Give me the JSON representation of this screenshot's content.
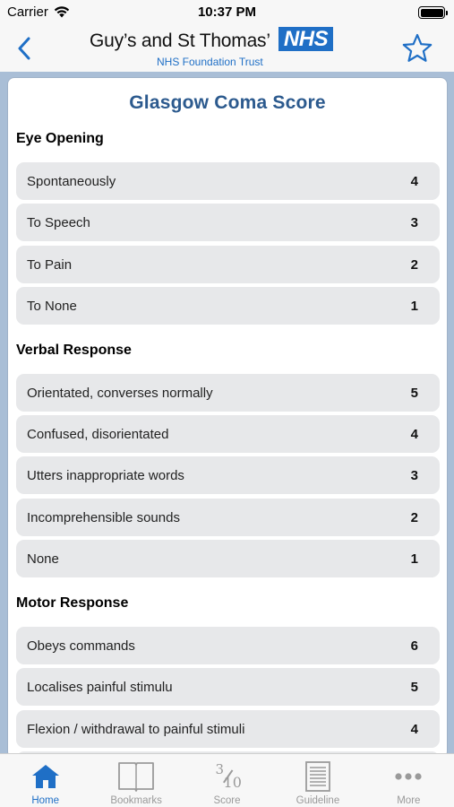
{
  "status": {
    "carrier": "Carrier",
    "time": "10:37 PM"
  },
  "header": {
    "org_name": "Guy’s and St Thomas’",
    "nhs_badge": "NHS",
    "trust_line": "NHS Foundation Trust"
  },
  "page": {
    "title": "Glasgow Coma Score"
  },
  "sections": [
    {
      "heading": "Eye Opening",
      "options": [
        {
          "label": "Spontaneously",
          "score": "4"
        },
        {
          "label": "To Speech",
          "score": "3"
        },
        {
          "label": "To Pain",
          "score": "2"
        },
        {
          "label": "To None",
          "score": "1"
        }
      ]
    },
    {
      "heading": "Verbal Response",
      "options": [
        {
          "label": "Orientated, converses normally",
          "score": "5"
        },
        {
          "label": "Confused, disorientated",
          "score": "4"
        },
        {
          "label": "Utters inappropriate words",
          "score": "3"
        },
        {
          "label": "Incomprehensible sounds",
          "score": "2"
        },
        {
          "label": "None",
          "score": "1"
        }
      ]
    },
    {
      "heading": "Motor Response",
      "options": [
        {
          "label": "Obeys commands",
          "score": "6"
        },
        {
          "label": "Localises painful stimulu",
          "score": "5"
        },
        {
          "label": "Flexion / withdrawal to painful stimuli",
          "score": "4"
        }
      ]
    }
  ],
  "tabs": [
    {
      "label": "Home",
      "icon": "home-icon",
      "active": true
    },
    {
      "label": "Bookmarks",
      "icon": "book-icon",
      "active": false
    },
    {
      "label": "Score",
      "icon": "score-fraction-icon",
      "fraction_num": "3",
      "fraction_den": "10",
      "active": false
    },
    {
      "label": "Guideline",
      "icon": "document-icon",
      "active": false
    },
    {
      "label": "More",
      "icon": "more-icon",
      "active": false
    }
  ],
  "colors": {
    "accent": "#1f6fc6",
    "title": "#2c5a8e",
    "option_bg": "#e7e8ea",
    "content_bg": "#a9bed6"
  }
}
